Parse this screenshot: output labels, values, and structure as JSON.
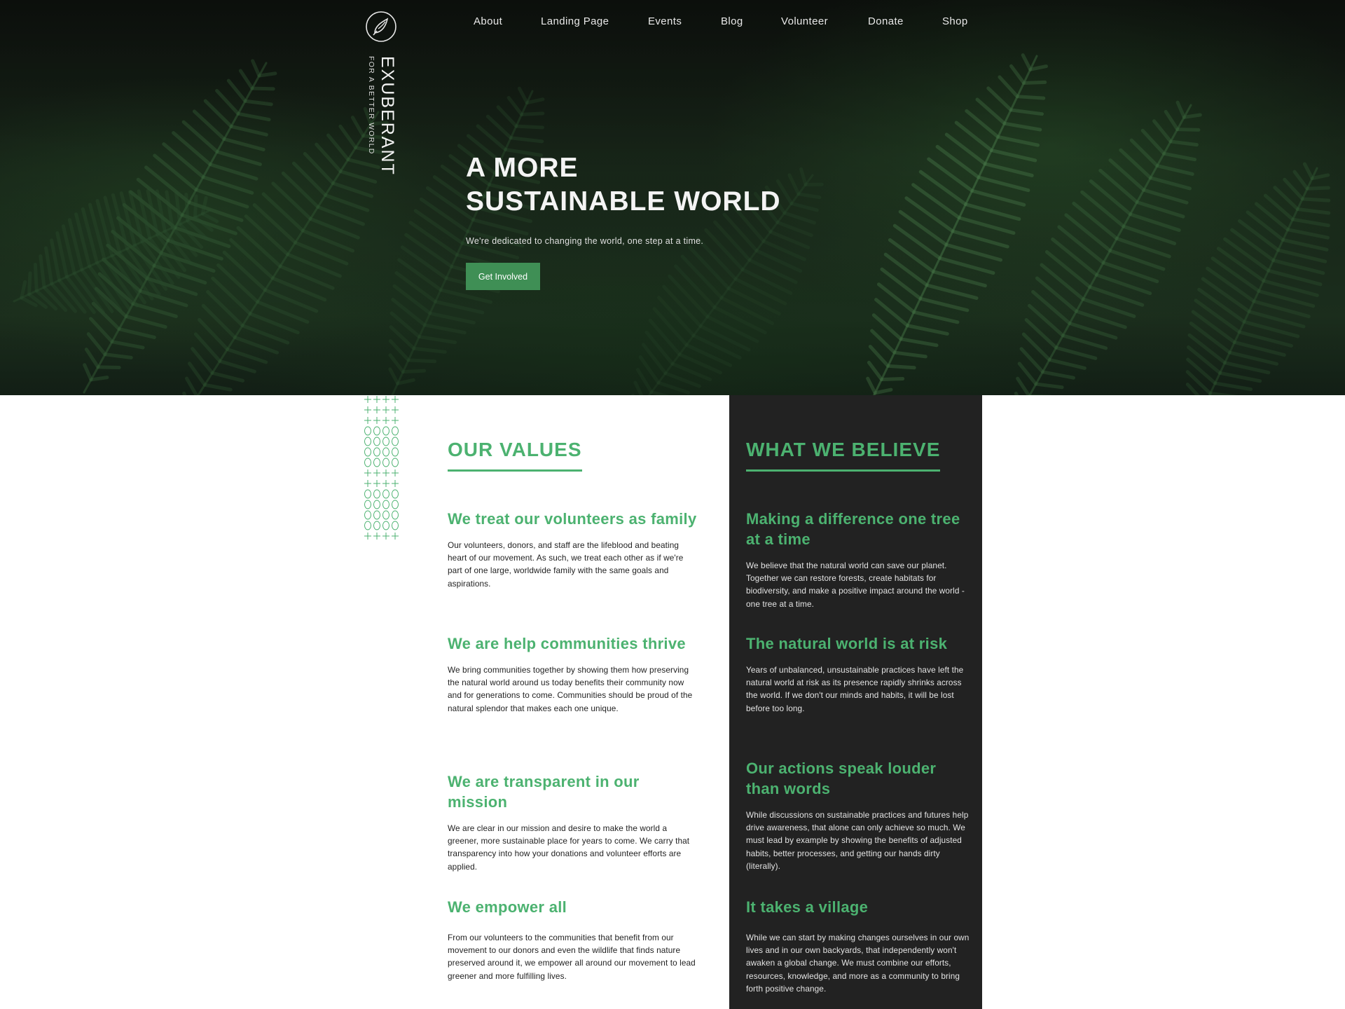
{
  "brand": {
    "name": "EXUBERANT",
    "tagline": "FOR A BETTER WORLD"
  },
  "nav": {
    "items": [
      "About",
      "Landing Page",
      "Events",
      "Blog",
      "Volunteer",
      "Donate",
      "Shop"
    ]
  },
  "hero": {
    "title_line1": "A MORE",
    "title_line2": "SUSTAINABLE WORLD",
    "subtitle": "We're dedicated to changing the world, one step at a time.",
    "cta": "Get Involved"
  },
  "values": {
    "title": "OUR VALUES",
    "items": [
      {
        "heading": "We treat our volunteers as family",
        "body": "Our volunteers, donors, and staff are the lifeblood and beating heart of our movement. As such, we treat each other as if we're part of one large, worldwide family with the same goals and aspirations."
      },
      {
        "heading": "We are help communities thrive",
        "body": "We bring communities together by showing them how preserving the natural world around us today benefits their community now and for generations to come. Communities should be proud of the natural splendor that makes each one unique."
      },
      {
        "heading": "We are transparent in our mission",
        "body": "We are clear in our mission and desire to make the world a greener, more sustainable place for years to come. We carry that transparency into how your donations and volunteer efforts are applied."
      },
      {
        "heading": "We empower all",
        "body": "From our volunteers to the communities that benefit from our movement to our donors and even the wildlife that finds nature preserved around it, we empower all around our movement to lead greener and more fulfilling lives."
      }
    ]
  },
  "believe": {
    "title": "WHAT WE BELIEVE",
    "items": [
      {
        "heading": "Making a difference one tree at a time",
        "body": "We believe that the natural world can save our planet. Together we can restore forests, create habitats for biodiversity, and make a positive impact around the world - one tree at a time."
      },
      {
        "heading": "The natural world is at risk",
        "body": "Years of unbalanced, unsustainable practices have left the natural world at risk as its presence rapidly shrinks across the world. If we don't our minds and habits, it will be lost before too long."
      },
      {
        "heading": "Our actions speak louder than words",
        "body": "While discussions on sustainable practices and futures help drive awareness, that alone can only achieve so much. We must lead by example by showing the benefits of adjusted habits, better processes, and getting our hands dirty (literally)."
      },
      {
        "heading": "It takes a village",
        "body": "While we can start by making changes ourselves in our own lives and in our own backyards, that independently won't awaken a global change. We must combine our efforts, resources, knowledge, and more as a community to bring forth positive change."
      }
    ]
  },
  "colors": {
    "accent": "#4cb270",
    "button": "#3f8f55",
    "dark_panel": "#222222"
  },
  "icons": {
    "logo": "leaf-seed-logo-icon",
    "pattern": "decorative-pattern"
  }
}
